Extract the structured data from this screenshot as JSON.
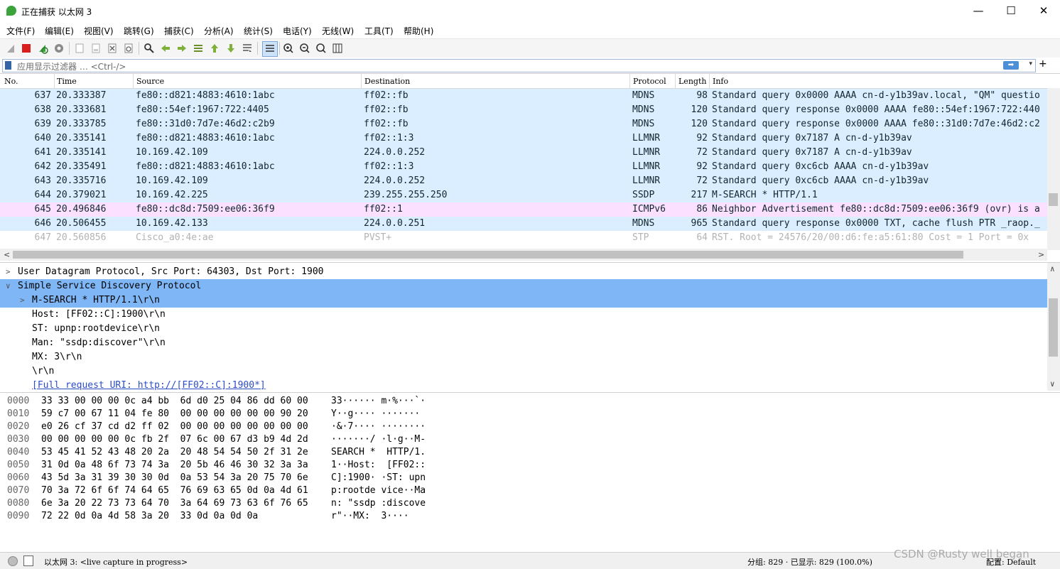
{
  "window": {
    "title": "正在捕获 以太网 3",
    "minimize": "—",
    "maximize": "☐",
    "close": "✕"
  },
  "menu": [
    "文件(F)",
    "编辑(E)",
    "视图(V)",
    "跳转(G)",
    "捕获(C)",
    "分析(A)",
    "统计(S)",
    "电话(Y)",
    "无线(W)",
    "工具(T)",
    "帮助(H)"
  ],
  "toolbar": {
    "icons": [
      "shark-fin-icon",
      "stop-icon",
      "restart-icon",
      "options-gear-icon",
      "open-file-icon",
      "save-file-icon",
      "close-file-icon",
      "reload-icon",
      "find-icon",
      "back-arrow-icon",
      "forward-arrow-icon",
      "goto-packet-icon",
      "first-packet-icon",
      "last-packet-icon",
      "autoscroll-icon",
      "colorize-icon",
      "zoom-in-icon",
      "zoom-out-icon",
      "zoom-normal-icon",
      "resize-columns-icon"
    ]
  },
  "filter": {
    "placeholder": "应用显示过滤器 … <Ctrl-/>",
    "apply": "➡",
    "dropdown": "▾",
    "add": "+"
  },
  "packet_list": {
    "columns": [
      "No.",
      "Time",
      "Source",
      "Destination",
      "Protocol",
      "Length",
      "Info"
    ],
    "rows": [
      {
        "no": "637",
        "time": "20.333387",
        "src": "fe80::d821:4883:4610:1abc",
        "dst": "ff02::fb",
        "proto": "MDNS",
        "len": "98",
        "info": "Standard query 0x0000 AAAA cn-d-y1b39av.local, \"QM\" questio",
        "bg": "#daeeff",
        "fg": "#12272e"
      },
      {
        "no": "638",
        "time": "20.333681",
        "src": "fe80::54ef:1967:722:4405",
        "dst": "ff02::fb",
        "proto": "MDNS",
        "len": "120",
        "info": "Standard query response 0x0000 AAAA fe80::54ef:1967:722:440",
        "bg": "#daeeff",
        "fg": "#12272e"
      },
      {
        "no": "639",
        "time": "20.333785",
        "src": "fe80::31d0:7d7e:46d2:c2b9",
        "dst": "ff02::fb",
        "proto": "MDNS",
        "len": "120",
        "info": "Standard query response 0x0000 AAAA fe80::31d0:7d7e:46d2:c2",
        "bg": "#daeeff",
        "fg": "#12272e"
      },
      {
        "no": "640",
        "time": "20.335141",
        "src": "fe80::d821:4883:4610:1abc",
        "dst": "ff02::1:3",
        "proto": "LLMNR",
        "len": "92",
        "info": "Standard query 0x7187 A cn-d-y1b39av",
        "bg": "#daeeff",
        "fg": "#12272e"
      },
      {
        "no": "641",
        "time": "20.335141",
        "src": "10.169.42.109",
        "dst": "224.0.0.252",
        "proto": "LLMNR",
        "len": "72",
        "info": "Standard query 0x7187 A cn-d-y1b39av",
        "bg": "#daeeff",
        "fg": "#12272e"
      },
      {
        "no": "642",
        "time": "20.335491",
        "src": "fe80::d821:4883:4610:1abc",
        "dst": "ff02::1:3",
        "proto": "LLMNR",
        "len": "92",
        "info": "Standard query 0xc6cb AAAA cn-d-y1b39av",
        "bg": "#daeeff",
        "fg": "#12272e"
      },
      {
        "no": "643",
        "time": "20.335716",
        "src": "10.169.42.109",
        "dst": "224.0.0.252",
        "proto": "LLMNR",
        "len": "72",
        "info": "Standard query 0xc6cb AAAA cn-d-y1b39av",
        "bg": "#daeeff",
        "fg": "#12272e"
      },
      {
        "no": "644",
        "time": "20.379021",
        "src": "10.169.42.225",
        "dst": "239.255.255.250",
        "proto": "SSDP",
        "len": "217",
        "info": "M-SEARCH * HTTP/1.1",
        "bg": "#daeeff",
        "fg": "#12272e"
      },
      {
        "no": "645",
        "time": "20.496846",
        "src": "fe80::dc8d:7509:ee06:36f9",
        "dst": "ff02::1",
        "proto": "ICMPv6",
        "len": "86",
        "info": "Neighbor Advertisement fe80::dc8d:7509:ee06:36f9 (ovr) is a",
        "bg": "#fce0ff",
        "fg": "#12272e"
      },
      {
        "no": "646",
        "time": "20.506455",
        "src": "10.169.42.133",
        "dst": "224.0.0.251",
        "proto": "MDNS",
        "len": "965",
        "info": "Standard query response 0x0000 TXT, cache flush PTR _raop._",
        "bg": "#daeeff",
        "fg": "#12272e"
      },
      {
        "no": "647",
        "time": "20.560856",
        "src": "Cisco_a0:4e:ae",
        "dst": "PVST+",
        "proto": "STP",
        "len": "64",
        "info": "RST. Root = 24576/20/00:d6:fe:a5:61:80  Cost = 1  Port = 0x",
        "bg": "#ffffff",
        "fg": "#b3b3b3"
      }
    ],
    "scroll_left": "<",
    "scroll_right": ">",
    "scroll_up": "∧",
    "scroll_down": "∨"
  },
  "details": {
    "rows": [
      {
        "indent": 0,
        "expander": ">",
        "text": "User Datagram Protocol, Src Port: 64303, Dst Port: 1900",
        "selected": false,
        "link": false
      },
      {
        "indent": 0,
        "expander": "∨",
        "text": "Simple Service Discovery Protocol",
        "selected": true,
        "link": false
      },
      {
        "indent": 1,
        "expander": ">",
        "text": "M-SEARCH * HTTP/1.1\\r\\n",
        "selected": true,
        "link": false
      },
      {
        "indent": 1,
        "expander": "",
        "text": "Host: [FF02::C]:1900\\r\\n",
        "selected": false,
        "link": false
      },
      {
        "indent": 1,
        "expander": "",
        "text": "ST: upnp:rootdevice\\r\\n",
        "selected": false,
        "link": false
      },
      {
        "indent": 1,
        "expander": "",
        "text": "Man: \"ssdp:discover\"\\r\\n",
        "selected": false,
        "link": false
      },
      {
        "indent": 1,
        "expander": "",
        "text": "MX: 3\\r\\n",
        "selected": false,
        "link": false
      },
      {
        "indent": 1,
        "expander": "",
        "text": "\\r\\n",
        "selected": false,
        "link": false
      },
      {
        "indent": 1,
        "expander": "",
        "text": "[Full request URI: http://[FF02::C]:1900*]",
        "selected": false,
        "link": true
      }
    ],
    "scroll_up": "∧",
    "scroll_down": "∨"
  },
  "bytes": {
    "rows": [
      {
        "offset": "0000",
        "hex": "33 33 00 00 00 0c a4 bb  6d d0 25 04 86 dd 60 00",
        "ascii": "33······ m·%···`·"
      },
      {
        "offset": "0010",
        "hex": "59 c7 00 67 11 04 fe 80  00 00 00 00 00 00 90 20",
        "ascii": "Y··g···· ······· "
      },
      {
        "offset": "0020",
        "hex": "e0 26 cf 37 cd d2 ff 02  00 00 00 00 00 00 00 00",
        "ascii": "·&·7···· ········"
      },
      {
        "offset": "0030",
        "hex": "00 00 00 00 00 0c fb 2f  07 6c 00 67 d3 b9 4d 2d",
        "ascii": "·······/ ·l·g··M-"
      },
      {
        "offset": "0040",
        "hex": "53 45 41 52 43 48 20 2a  20 48 54 54 50 2f 31 2e",
        "ascii": "SEARCH *  HTTP/1."
      },
      {
        "offset": "0050",
        "hex": "31 0d 0a 48 6f 73 74 3a  20 5b 46 46 30 32 3a 3a",
        "ascii": "1··Host:  [FF02::"
      },
      {
        "offset": "0060",
        "hex": "43 5d 3a 31 39 30 30 0d  0a 53 54 3a 20 75 70 6e",
        "ascii": "C]:1900· ·ST: upn"
      },
      {
        "offset": "0070",
        "hex": "70 3a 72 6f 6f 74 64 65  76 69 63 65 0d 0a 4d 61",
        "ascii": "p:rootde vice··Ma"
      },
      {
        "offset": "0080",
        "hex": "6e 3a 20 22 73 73 64 70  3a 64 69 73 63 6f 76 65",
        "ascii": "n: \"ssdp :discove"
      },
      {
        "offset": "0090",
        "hex": "72 22 0d 0a 4d 58 3a 20  33 0d 0a 0d 0a",
        "ascii": "r\"··MX:  3····"
      }
    ]
  },
  "status": {
    "interface": "以太网 3: <live capture in progress>",
    "packets": "分组: 829 · 已显示: 829 (100.0%)",
    "profile": "配置: Default"
  },
  "watermark": "CSDN @Rusty well began",
  "colors": {
    "udp_row": "#daeeff",
    "icmpv6_row": "#fce0ff",
    "selected_detail": "#7fb6f5",
    "link": "#2b4cc6"
  }
}
